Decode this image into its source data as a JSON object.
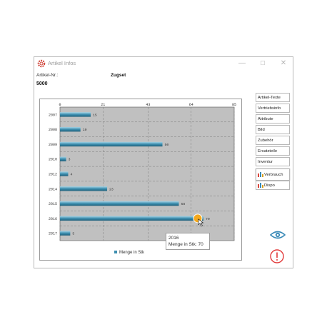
{
  "window": {
    "title": "Artikel Infos",
    "controls": {
      "minimize": "—",
      "maximize": "☐",
      "close": "✕"
    }
  },
  "header": {
    "article_no_label": "Artikel-Nr.:",
    "article_name": "Zugset",
    "article_no_value": "5000"
  },
  "tabs": [
    {
      "label": "Artikel-Texte",
      "active": false,
      "icon": ""
    },
    {
      "label": "Vertriebsinfo",
      "active": false,
      "icon": ""
    },
    {
      "label": "Attribute",
      "active": false,
      "icon": ""
    },
    {
      "label": "Bild",
      "active": false,
      "icon": ""
    },
    {
      "label": "Zubehör",
      "active": false,
      "icon": ""
    },
    {
      "label": "Ersatzteile",
      "active": false,
      "icon": ""
    },
    {
      "label": "Inventur",
      "active": false,
      "icon": ""
    },
    {
      "label": "Verbrauch",
      "active": true,
      "icon": "bar-chart-icon"
    },
    {
      "label": "Dispo",
      "active": false,
      "icon": "bar-chart-icon"
    }
  ],
  "side_icons": {
    "view": "eye-icon",
    "stop": "stop-icon"
  },
  "colors": {
    "bar": "#3d8fb0",
    "bar_highlight": "#a6d4e6",
    "plot_bg": "#c0c0c0",
    "marker": "#f4a81d",
    "stop_red": "#e23b3b",
    "eye_blue": "#3b8bb8"
  },
  "tooltip": {
    "line1": "2016",
    "line2": "Menge in Stk: 70"
  },
  "chart_data": {
    "type": "bar",
    "orientation": "horizontal",
    "categories": [
      "2007",
      "2008",
      "2009",
      "2010",
      "2012",
      "2014",
      "2015",
      "2016",
      "2017"
    ],
    "series": [
      {
        "name": "Menge in Stk",
        "values": [
          15,
          10,
          50,
          3,
          4,
          23,
          58,
          70,
          5
        ]
      }
    ],
    "xlim": [
      0,
      85
    ],
    "x_ticks": [
      "0",
      "21",
      "43",
      "64",
      "85"
    ],
    "grid": true,
    "legend_position": "bottom",
    "highlighted": {
      "category": "2016",
      "value": 70
    }
  }
}
